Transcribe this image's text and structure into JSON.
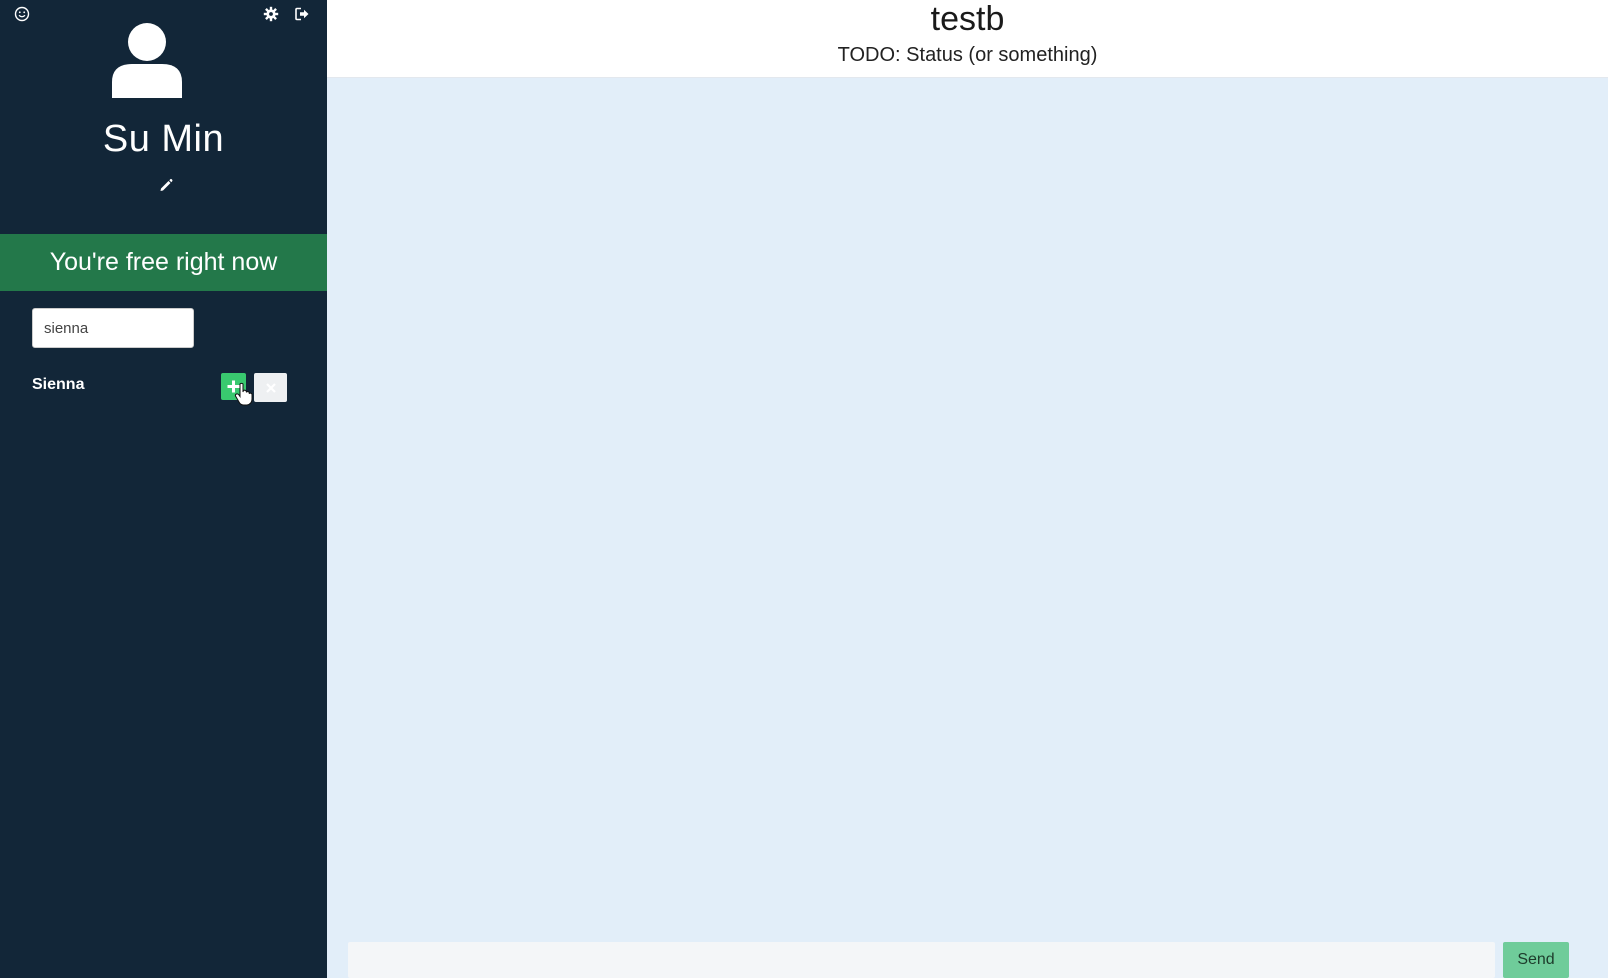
{
  "sidebar": {
    "top_icons": {
      "left": "smiley-icon",
      "settings": "gear-icon",
      "logout": "sign-out-icon"
    },
    "avatar_icon": "user-icon",
    "profile_name": "Su Min",
    "edit_icon": "pencil-icon",
    "status_text": "You're free right now",
    "search": {
      "value": "sienna",
      "placeholder": ""
    },
    "results": [
      {
        "name": "Sienna",
        "add_icon": "plus-icon",
        "ignore_icon": "close-icon"
      }
    ]
  },
  "chat": {
    "title": "testb",
    "status": "TODO: Status (or something)",
    "input_value": "",
    "send_label": "Send"
  },
  "colors": {
    "sidebar_bg": "#122638",
    "status_banner": "#23784a",
    "add_button": "#39c96f",
    "main_bg": "#e2eef9",
    "send_button": "#6fcc9a"
  }
}
